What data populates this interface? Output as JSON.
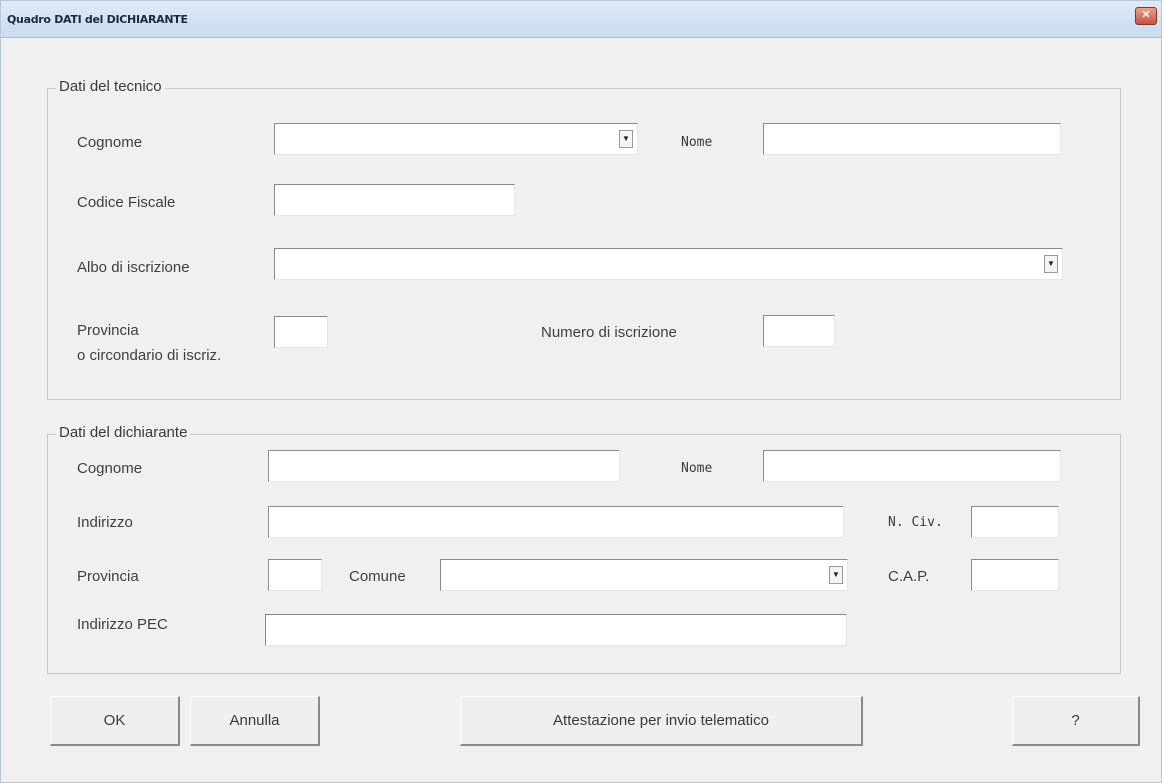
{
  "window": {
    "title": "Quadro DATI del DICHIARANTE",
    "close_glyph": "✕"
  },
  "tecnico": {
    "group_title": "Dati del tecnico",
    "cognome_label": "Cognome",
    "cognome_value": "",
    "nome_label": "Nome",
    "nome_value": "",
    "codice_fiscale_label": "Codice Fiscale",
    "codice_fiscale_value": "",
    "albo_label": "Albo di iscrizione",
    "albo_value": "",
    "provincia_label_line1": "Provincia",
    "provincia_label_line2": "o circondario di iscriz.",
    "provincia_value": "",
    "numero_iscrizione_label": "Numero di iscrizione",
    "numero_iscrizione_value": ""
  },
  "dichiarante": {
    "group_title": "Dati del dichiarante",
    "cognome_label": "Cognome",
    "cognome_value": "",
    "nome_label": "Nome",
    "nome_value": "",
    "indirizzo_label": "Indirizzo",
    "indirizzo_value": "",
    "ncivico_label": "N. Civ.",
    "ncivico_value": "",
    "provincia_label": "Provincia",
    "provincia_value": "",
    "comune_label": "Comune",
    "comune_value": "",
    "cap_label": "C.A.P.",
    "cap_value": "",
    "pec_label": "Indirizzo PEC",
    "pec_value": ""
  },
  "buttons": {
    "ok": "OK",
    "annulla": "Annulla",
    "attestazione": "Attestazione per invio telematico",
    "help": "?"
  },
  "icons": {
    "combo_arrow": "▼"
  }
}
